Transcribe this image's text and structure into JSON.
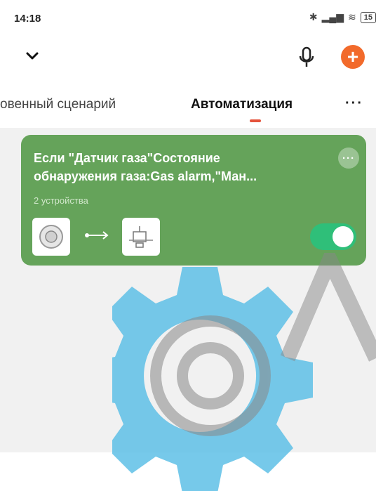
{
  "status_bar": {
    "time": "14:18",
    "battery": "15"
  },
  "tabs": {
    "items": [
      {
        "label": "овенный сценарий",
        "active": false
      },
      {
        "label": "Автоматизация",
        "active": true
      }
    ],
    "more": "···"
  },
  "card": {
    "title_line1": "Если \"Датчик газа\"Состояние",
    "title_line2": "обнаружения газа:Gas alarm,\"Ман...",
    "subtitle": "2 устройства",
    "menu": "···",
    "enabled": true
  },
  "colors": {
    "card": "#65a35a",
    "accent": "#f26a2b",
    "toggle": "#2fbf79",
    "indicator": "#e5533c"
  }
}
